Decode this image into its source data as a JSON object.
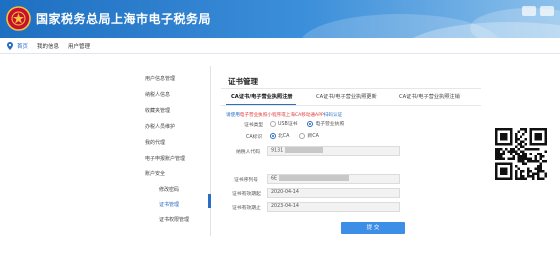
{
  "header": {
    "site_title": "国家税务总局上海市电子税务局"
  },
  "breadcrumb": {
    "items": [
      "首页",
      "我的信息",
      "用户管理"
    ]
  },
  "sidebar": {
    "items": [
      {
        "label": "用户信息管理",
        "active": false,
        "sub": false
      },
      {
        "label": "纳税人信息",
        "active": false,
        "sub": false
      },
      {
        "label": "收藏夹管理",
        "active": false,
        "sub": false
      },
      {
        "label": "办税人员维护",
        "active": false,
        "sub": false
      },
      {
        "label": "我的代理",
        "active": false,
        "sub": false
      },
      {
        "label": "电子申报账户管理",
        "active": false,
        "sub": false
      },
      {
        "label": "账户安全",
        "active": false,
        "sub": false
      },
      {
        "label": "修改密码",
        "active": false,
        "sub": true
      },
      {
        "label": "证书管理",
        "active": true,
        "sub": true
      },
      {
        "label": "证书权限管理",
        "active": false,
        "sub": true
      }
    ]
  },
  "main": {
    "title": "证书管理",
    "tabs": [
      {
        "label": "CA证书/电子营业执照注册",
        "active": true
      },
      {
        "label": "CA证书/电子营业执照更新",
        "active": false
      },
      {
        "label": "CA证书/电子营业执照注销",
        "active": false
      }
    ],
    "notice": {
      "prefix": "请使用",
      "red": "电子营业执照小程序或上海CA移动通APP",
      "suffix": "扫码认证"
    },
    "form": {
      "cert_type_label": "证书类型",
      "cert_type_options": [
        {
          "label": "USB证书",
          "selected": false
        },
        {
          "label": "电子营业执照",
          "selected": true
        }
      ],
      "ca_label": "CA标识",
      "ca_options": [
        {
          "label": "北CA",
          "selected": true
        },
        {
          "label": "新CA",
          "selected": false
        }
      ],
      "taxpayer_code_label": "纳税人代码",
      "taxpayer_code_value": "9131",
      "cert_serial_label": "证书序列号",
      "cert_serial_value": "6E",
      "valid_from_label": "证书有效期起",
      "valid_from_value": "2020-04-14",
      "valid_to_label": "证书有效期止",
      "valid_to_value": "2023-04-14"
    },
    "submit_label": "提 交"
  },
  "colors": {
    "header_start": "#1e6fc1",
    "accent": "#2b6cc4",
    "submit": "#3d8ee6",
    "notice_red": "#e03a3a"
  },
  "icons": [
    "tax-emblem-icon",
    "location-pin-icon",
    "qr-code-icon"
  ]
}
